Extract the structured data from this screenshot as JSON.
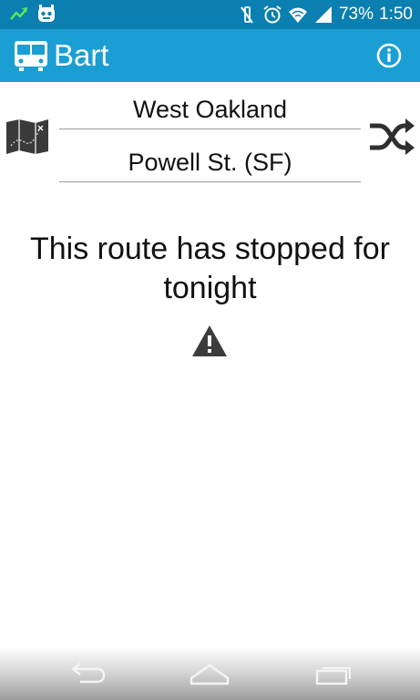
{
  "status_bar": {
    "battery_percent": "73%",
    "time": "1:50",
    "icons": [
      "activity-icon",
      "cyanogen-icon",
      "mute-icon",
      "alarm-icon",
      "wifi-icon",
      "signal-icon",
      "battery-icon"
    ]
  },
  "action_bar": {
    "title": "Bart",
    "logo_icon": "train-icon",
    "info_icon": "info-icon",
    "colors": {
      "status_bar": "#0a7fb0",
      "action_bar": "#1a9ed4"
    }
  },
  "route": {
    "origin": "West Oakland",
    "destination": "Powell St. (SF)",
    "map_icon": "map-icon",
    "swap_icon": "shuffle-icon"
  },
  "message": {
    "text": "This route has stopped for tonight",
    "icon": "warning-icon"
  },
  "nav_bar": {
    "buttons": [
      "back-icon",
      "home-icon",
      "recent-apps-icon"
    ]
  }
}
